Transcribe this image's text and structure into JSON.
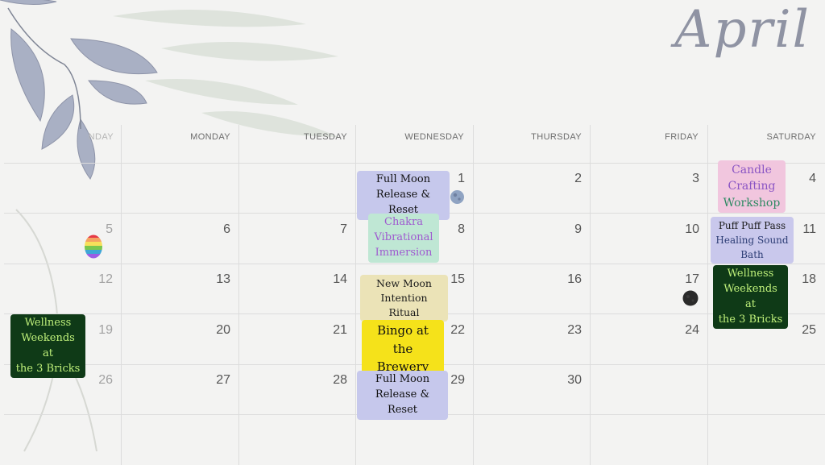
{
  "calendar": {
    "month": "April",
    "days": [
      "SUNDAY",
      "MONDAY",
      "TUESDAY",
      "WEDNESDAY",
      "THURSDAY",
      "FRIDAY",
      "SATURDAY"
    ],
    "visible_day0": "NDAY",
    "weeks": [
      [
        "",
        "",
        "",
        "1",
        "2",
        "3",
        "4"
      ],
      [
        "5",
        "6",
        "7",
        "8",
        "9",
        "10",
        "11"
      ],
      [
        "12",
        "13",
        "14",
        "15",
        "16",
        "17",
        "18"
      ],
      [
        "19",
        "20",
        "21",
        "22",
        "23",
        "24",
        "25"
      ],
      [
        "26",
        "27",
        "28",
        "29",
        "30",
        "",
        ""
      ]
    ]
  },
  "events": {
    "apr1": [
      "Full Moon",
      "Release & Reset"
    ],
    "apr4": [
      "Candle",
      "Crafting",
      "Workshop"
    ],
    "apr8": [
      "Chakra",
      "Vibrational",
      "Immersion"
    ],
    "apr11": [
      "Puff Puff Pass",
      "Healing Sound",
      "Bath"
    ],
    "apr15": [
      "New Moon",
      "Intention Ritual"
    ],
    "apr18": [
      "Wellness",
      "Weekends at",
      "the 3 Bricks"
    ],
    "apr19": [
      "Wellness",
      "Weekends at",
      "the 3 Bricks"
    ],
    "apr22": [
      "Bingo at the",
      "Brewery"
    ],
    "apr29": [
      "Full Moon",
      "Release & Reset"
    ]
  },
  "icons": {
    "full_moon": "full-moon-icon",
    "new_moon": "new-moon-icon",
    "easter_egg": "easter-egg-icon"
  },
  "colors": {
    "lavender": "#c6c8ec",
    "pink": "#f1c6de",
    "mint": "#bfe7d4",
    "cream": "#ebe3b7",
    "yellow": "#f5e21a",
    "dark_green": "#0f3a17"
  }
}
